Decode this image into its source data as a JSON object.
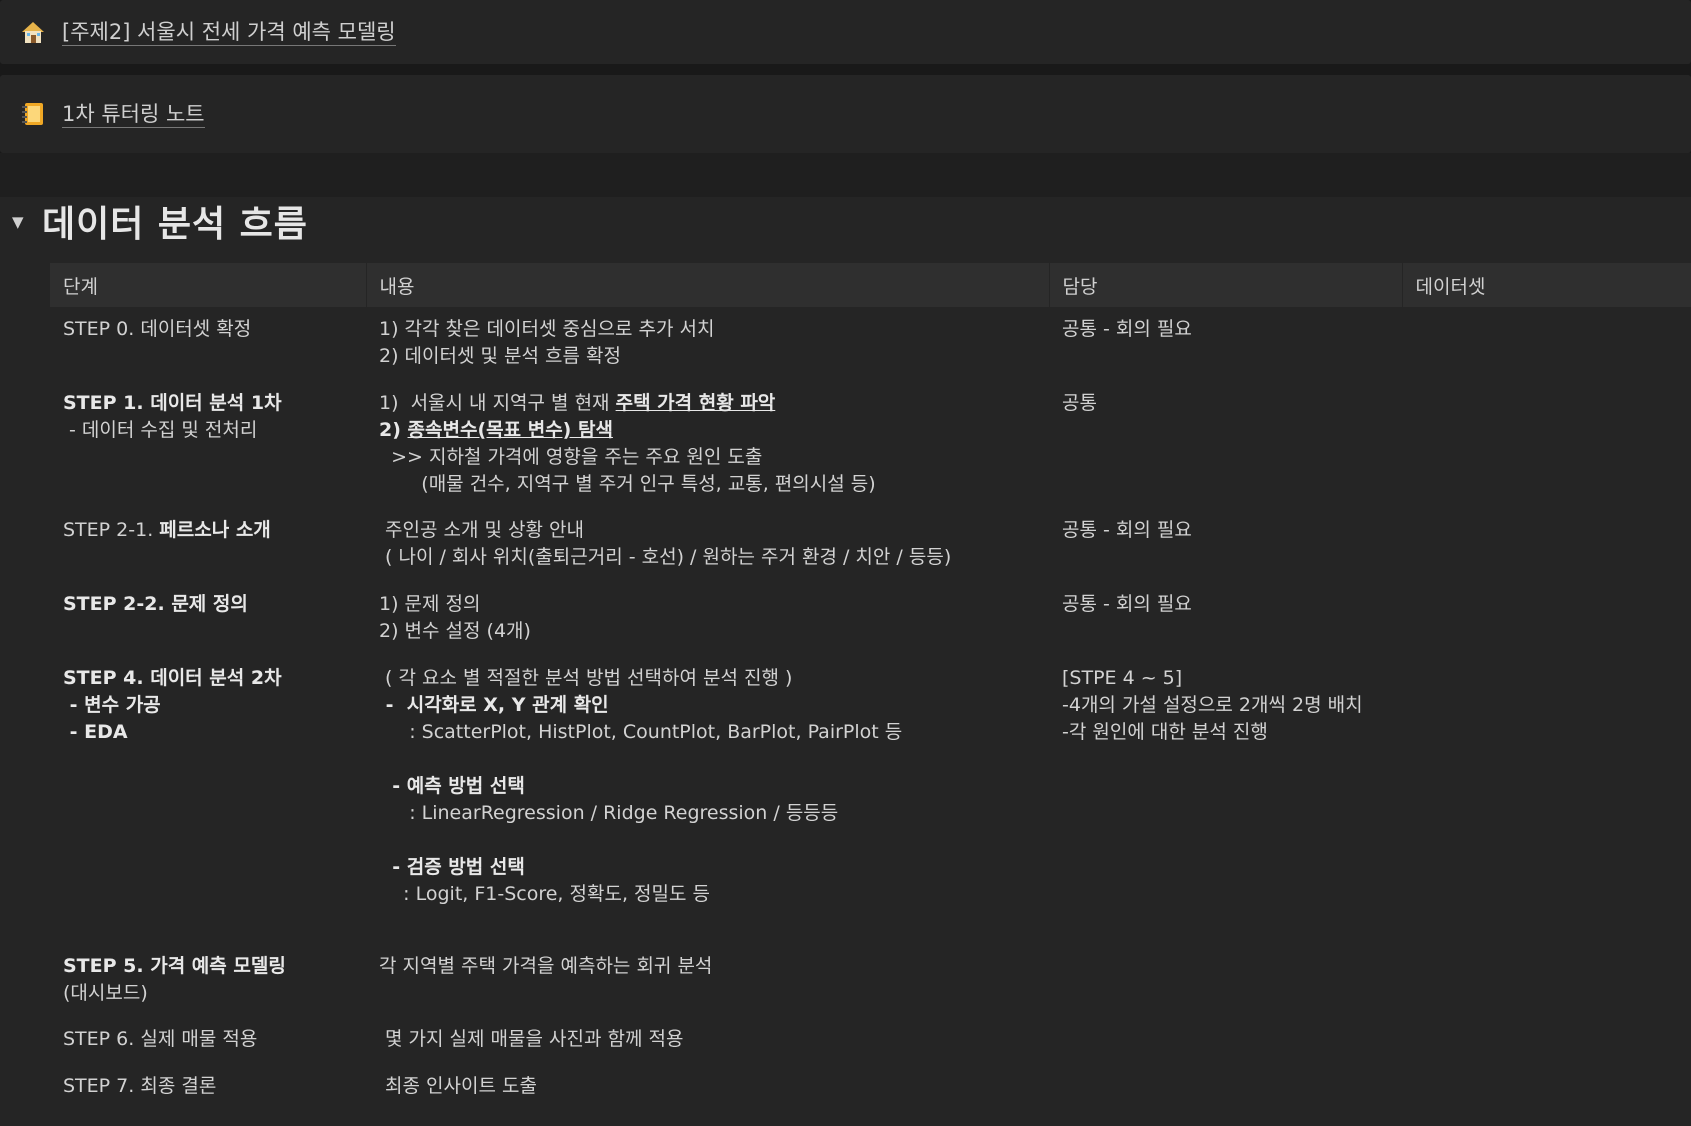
{
  "links": [
    {
      "icon": "house-icon",
      "label": "[주제2] 서울시 전세 가격 예측 모델링"
    },
    {
      "icon": "notebook-icon",
      "label": "1차 튜터링 노트"
    }
  ],
  "section": {
    "heading": "데이터 분석 흐름",
    "toggle_icon": "triangle-down-icon"
  },
  "table": {
    "headers": [
      "단계",
      "내용",
      "담당",
      "데이터셋"
    ],
    "rows": [
      {
        "step": [
          "STEP 0. 데이터셋 확정"
        ],
        "content": [
          "1) 각각 찾은 데이터셋 중심으로 추가 서치",
          "2) 데이터셋 및 분석 흐름 확정"
        ],
        "owner": [
          "공통 - 회의 필요"
        ]
      },
      {
        "step_prefix": "STEP 1. ",
        "step_bold": "데이터 분석 1차",
        "step_sub": " - 데이터 수집 및 전처리",
        "c1_plain": "1)  서울시 내 지역구 별 현재 ",
        "c1_bold": "주택 가격 현황 파악",
        "c2_num": "2) ",
        "c2_bold": "종속변수(목표 변수) 탐색",
        "c3": "  >> 지하철 가격에 영향을 주는 주요 원인 도출",
        "c4": "       (매물 건수, 지역구 별 주거 인구 특성, 교통, 편의시설 등)",
        "owner": [
          "공통"
        ]
      },
      {
        "step_prefix": "STEP 2-1. ",
        "step_bold": "페르소나 소개",
        "content": [
          " 주인공 소개 및 상황 안내",
          " ( 나이 / 회사 위치(출퇴근거리 - 호선) / 원하는 주거 환경 / 치안 / 등등)"
        ],
        "owner": [
          "공통 - 회의 필요"
        ]
      },
      {
        "step_bold_all": "STEP 2-2. 문제 정의",
        "content": [
          "1) 문제 정의",
          "2) 변수 설정 (4개)"
        ],
        "owner": [
          "공통 - 회의 필요"
        ]
      },
      {
        "step_lines": [
          "STEP 4. 데이터 분석 2차",
          " - 변수 가공",
          " - EDA"
        ],
        "c1": " ( 각 요소 별 적절한 분석 방법 선택하여 분석 진행 )",
        "c2_prefix": " -  ",
        "c2_bold": "시각화로 X, Y 관계 확인",
        "c3": "     : ScatterPlot, HistPlot, CountPlot, BarPlot, PairPlot 등",
        "c4": "  - 예측 방법 선택",
        "c5": "     : LinearRegression / Ridge Regression / 등등등",
        "c6": "  - 검증 방법 선택",
        "c7": "    : Logit, F1-Score, 정확도, 정밀도 등",
        "owner": [
          "[STPE 4 ~ 5]",
          "-4개의 가설 설정으로 2개씩 2명 배치",
          "-각 원인에 대한 분석 진행"
        ]
      },
      {
        "step_bold": "STEP 5. 가격 예측 모델링",
        "step_sub": "(대시보드)",
        "content": [
          "각 지역별 주택 가격을 예측하는 회귀 분석"
        ],
        "owner": []
      },
      {
        "step": [
          "STEP 6. 실제 매물 적용"
        ],
        "content": [
          " 몇 가지 실제 매물을 사진과 함께 적용"
        ],
        "owner": []
      },
      {
        "step": [
          "STEP 7. 최종 결론"
        ],
        "content": [
          " 최종 인사이트 도출"
        ],
        "owner": []
      }
    ]
  }
}
